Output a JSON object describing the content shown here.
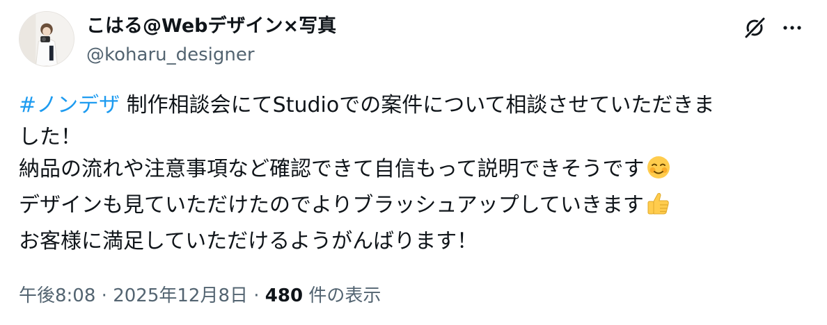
{
  "user": {
    "display_name": "こはる@Webデザイン×写真",
    "handle": "@koharu_designer"
  },
  "actions": {
    "grok_icon": "grok-icon",
    "more_icon": "more-icon"
  },
  "tweet": {
    "hashtag": "#ノンデザ",
    "line1_rest": " 制作相談会にてStudioでの案件について相談させていただきま",
    "line2": "した！",
    "line3": "納品の流れや注意事項など確認できて自信もって説明できそうです",
    "line4": "デザインも見ていただけたのでよりブラッシュアップしていきます",
    "line5": "お客様に満足していただけるようがんばります！"
  },
  "meta": {
    "time": "午後8:08",
    "sep1": " · ",
    "date": "2025年12月8日",
    "sep2": " · ",
    "views_count": "480",
    "views_label": " 件の表示"
  },
  "colors": {
    "link": "#1d9bf0",
    "secondary": "#536471",
    "text": "#0f1419"
  }
}
